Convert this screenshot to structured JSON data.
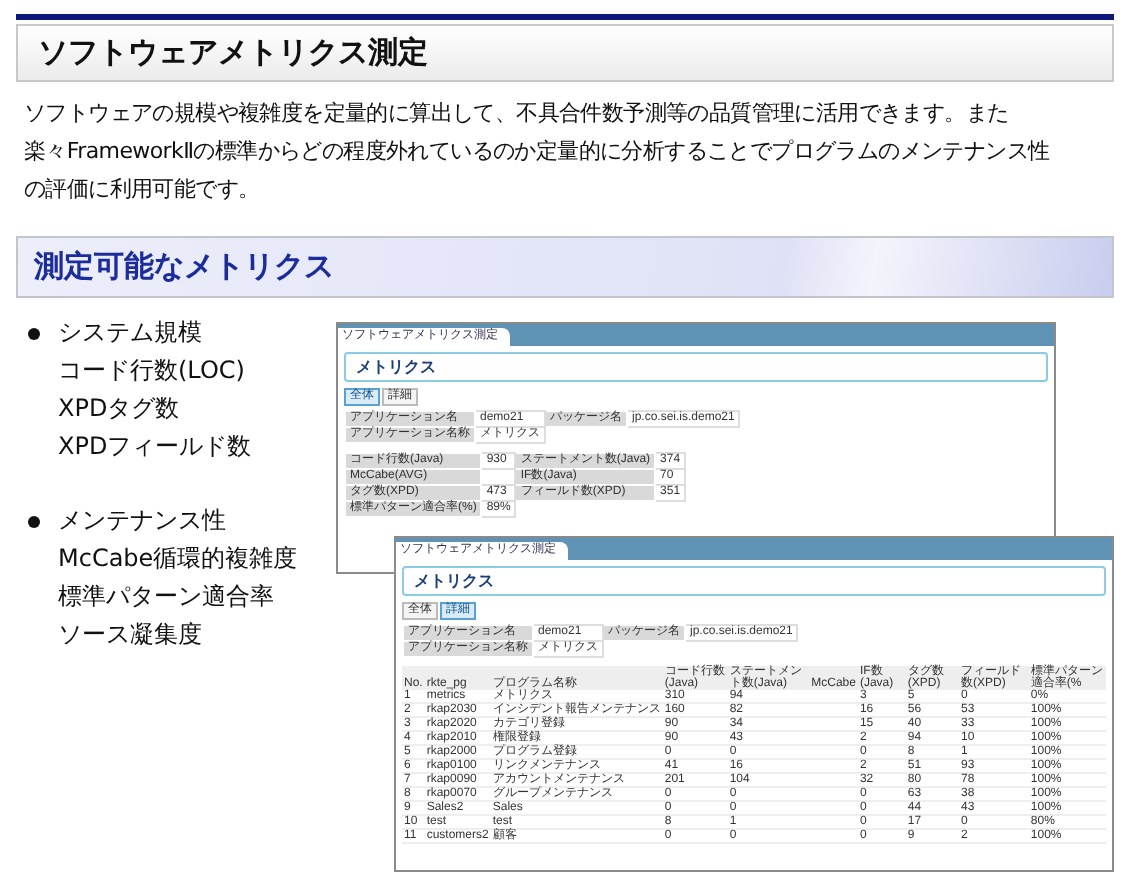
{
  "header": {
    "title": "ソフトウェアメトリクス測定"
  },
  "intro": [
    "ソフトウェアの規模や複雑度を定量的に算出して、不具合件数予測等の品質管理に活用できます。また",
    "楽々FrameworkⅡの標準からどの程度外れているのか定量的に分析することでプログラムのメンテナンス性",
    "の評価に利用可能です。"
  ],
  "section": {
    "title": "測定可能なメトリクス"
  },
  "metric_groups": [
    {
      "title": "システム規模",
      "items": [
        "コード行数(LOC)",
        "XPDタグ数",
        "XPDフィールド数"
      ]
    },
    {
      "title": "メンテナンス性",
      "items": [
        "McCabe循環的複雑度",
        "標準パターン適合率",
        "ソース凝集度"
      ]
    }
  ],
  "screenshots": [
    {
      "kind": "summary",
      "window_title": "ソフトウェアメトリクス測定",
      "heading": "メトリクス",
      "tabs": [
        {
          "label": "全体",
          "selected": true
        },
        {
          "label": "詳細",
          "selected": false
        }
      ],
      "info_rows": [
        [
          {
            "label": "アプリケーション名",
            "value": "demo21"
          },
          {
            "label": "パッケージ名",
            "value": "jp.co.sei.is.demo21"
          }
        ],
        [
          {
            "label": "アプリケーション名称",
            "value": "メトリクス"
          }
        ]
      ],
      "summary_rows": [
        [
          {
            "label": "コード行数(Java)",
            "value": "930"
          },
          {
            "label": "ステートメント数(Java)",
            "value": "374"
          }
        ],
        [
          {
            "label": "McCabe(AVG)"
          },
          {
            "label": "IF数(Java)",
            "value": "70"
          }
        ],
        [
          {
            "label": "タグ数(XPD)",
            "value": "473"
          },
          {
            "label": "フィールド数(XPD)",
            "value": "351"
          }
        ],
        [
          {
            "label": "標準パターン適合率(%)",
            "value": "89%"
          }
        ]
      ]
    },
    {
      "kind": "detail",
      "window_title": "ソフトウェアメトリクス測定",
      "heading": "メトリクス",
      "tabs": [
        {
          "label": "全体",
          "selected": false
        },
        {
          "label": "詳細",
          "selected": true
        }
      ],
      "info_rows": [
        [
          {
            "label": "アプリケーション名",
            "value": "demo21"
          },
          {
            "label": "パッケージ名",
            "value": "jp.co.sei.is.demo21"
          }
        ],
        [
          {
            "label": "アプリケーション名称",
            "value": "メトリクス"
          }
        ]
      ],
      "table": {
        "columns": [
          "No.",
          "rkte_pg",
          "プログラム名称",
          "コード行数(Java)",
          "ステートメント数(Java)",
          "McCabe",
          "IF数(Java)",
          "タグ数(XPD)",
          "フィールド数(XPD)",
          "標準パターン適合率(%"
        ],
        "rows": [
          {
            "no": "1",
            "pg": "metrics",
            "name": "メトリクス",
            "loc": "310",
            "statements": "94",
            "if_count": "3",
            "tags": "5",
            "fields": "0",
            "rate": "0%"
          },
          {
            "no": "2",
            "pg": "rkap2030",
            "name": "インシデント報告メンテナンス",
            "loc": "160",
            "statements": "82",
            "if_count": "16",
            "tags": "56",
            "fields": "53",
            "rate": "100%"
          },
          {
            "no": "3",
            "pg": "rkap2020",
            "name": "カテゴリ登録",
            "loc": "90",
            "statements": "34",
            "if_count": "15",
            "tags": "40",
            "fields": "33",
            "rate": "100%"
          },
          {
            "no": "4",
            "pg": "rkap2010",
            "name": "権限登録",
            "loc": "90",
            "statements": "43",
            "if_count": "2",
            "tags": "94",
            "fields": "10",
            "rate": "100%"
          },
          {
            "no": "5",
            "pg": "rkap2000",
            "name": "プログラム登録",
            "loc": "0",
            "statements": "0",
            "if_count": "0",
            "tags": "8",
            "fields": "1",
            "rate": "100%"
          },
          {
            "no": "6",
            "pg": "rkap0100",
            "name": "リンクメンテナンス",
            "loc": "41",
            "statements": "16",
            "if_count": "2",
            "tags": "51",
            "fields": "93",
            "rate": "100%"
          },
          {
            "no": "7",
            "pg": "rkap0090",
            "name": "アカウントメンテナンス",
            "loc": "201",
            "statements": "104",
            "if_count": "32",
            "tags": "80",
            "fields": "78",
            "rate": "100%"
          },
          {
            "no": "8",
            "pg": "rkap0070",
            "name": "グループメンテナンス",
            "loc": "0",
            "statements": "0",
            "if_count": "0",
            "tags": "63",
            "fields": "38",
            "rate": "100%"
          },
          {
            "no": "9",
            "pg": "Sales2",
            "name": "Sales",
            "loc": "0",
            "statements": "0",
            "if_count": "0",
            "tags": "44",
            "fields": "43",
            "rate": "100%"
          },
          {
            "no": "10",
            "pg": "test",
            "name": "test",
            "loc": "8",
            "statements": "1",
            "if_count": "0",
            "tags": "17",
            "fields": "0",
            "rate": "80%"
          },
          {
            "no": "11",
            "pg": "customers2",
            "name": "顧客",
            "loc": "0",
            "statements": "0",
            "if_count": "0",
            "tags": "9",
            "fields": "2",
            "rate": "100%"
          }
        ]
      }
    }
  ]
}
